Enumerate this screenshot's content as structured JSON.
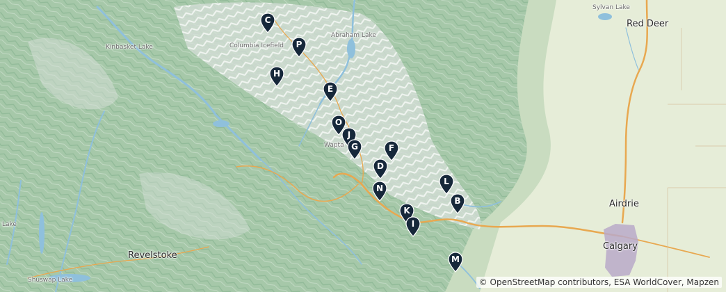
{
  "map": {
    "places": {
      "red_deer": "Red Deer",
      "sylvan_lake": "Sylvan Lake",
      "airdrie": "Airdrie",
      "calgary": "Calgary",
      "revelstoke": "Revelstoke",
      "kinbasket_lake": "Kinbasket Lake",
      "columbia_icefield": "Columbia Icefield",
      "abraham_lake": "Abraham Lake",
      "wapta": "Wapta",
      "shuswap_lake": "Shuswap Lake",
      "lake_edge": "Lake"
    },
    "markers": [
      "C",
      "P",
      "H",
      "E",
      "O",
      "J",
      "G",
      "F",
      "D",
      "N",
      "L",
      "B",
      "K",
      "I",
      "M"
    ],
    "attribution": "© OpenStreetMap contributors, ESA WorldCover, Mapzen",
    "colors": {
      "marker": "#16283a",
      "forest": "#9fc4a4",
      "prairie": "#e6edd8",
      "water": "#8fc0dc",
      "road": "#e8a850",
      "city": "#b9a9c9"
    }
  }
}
